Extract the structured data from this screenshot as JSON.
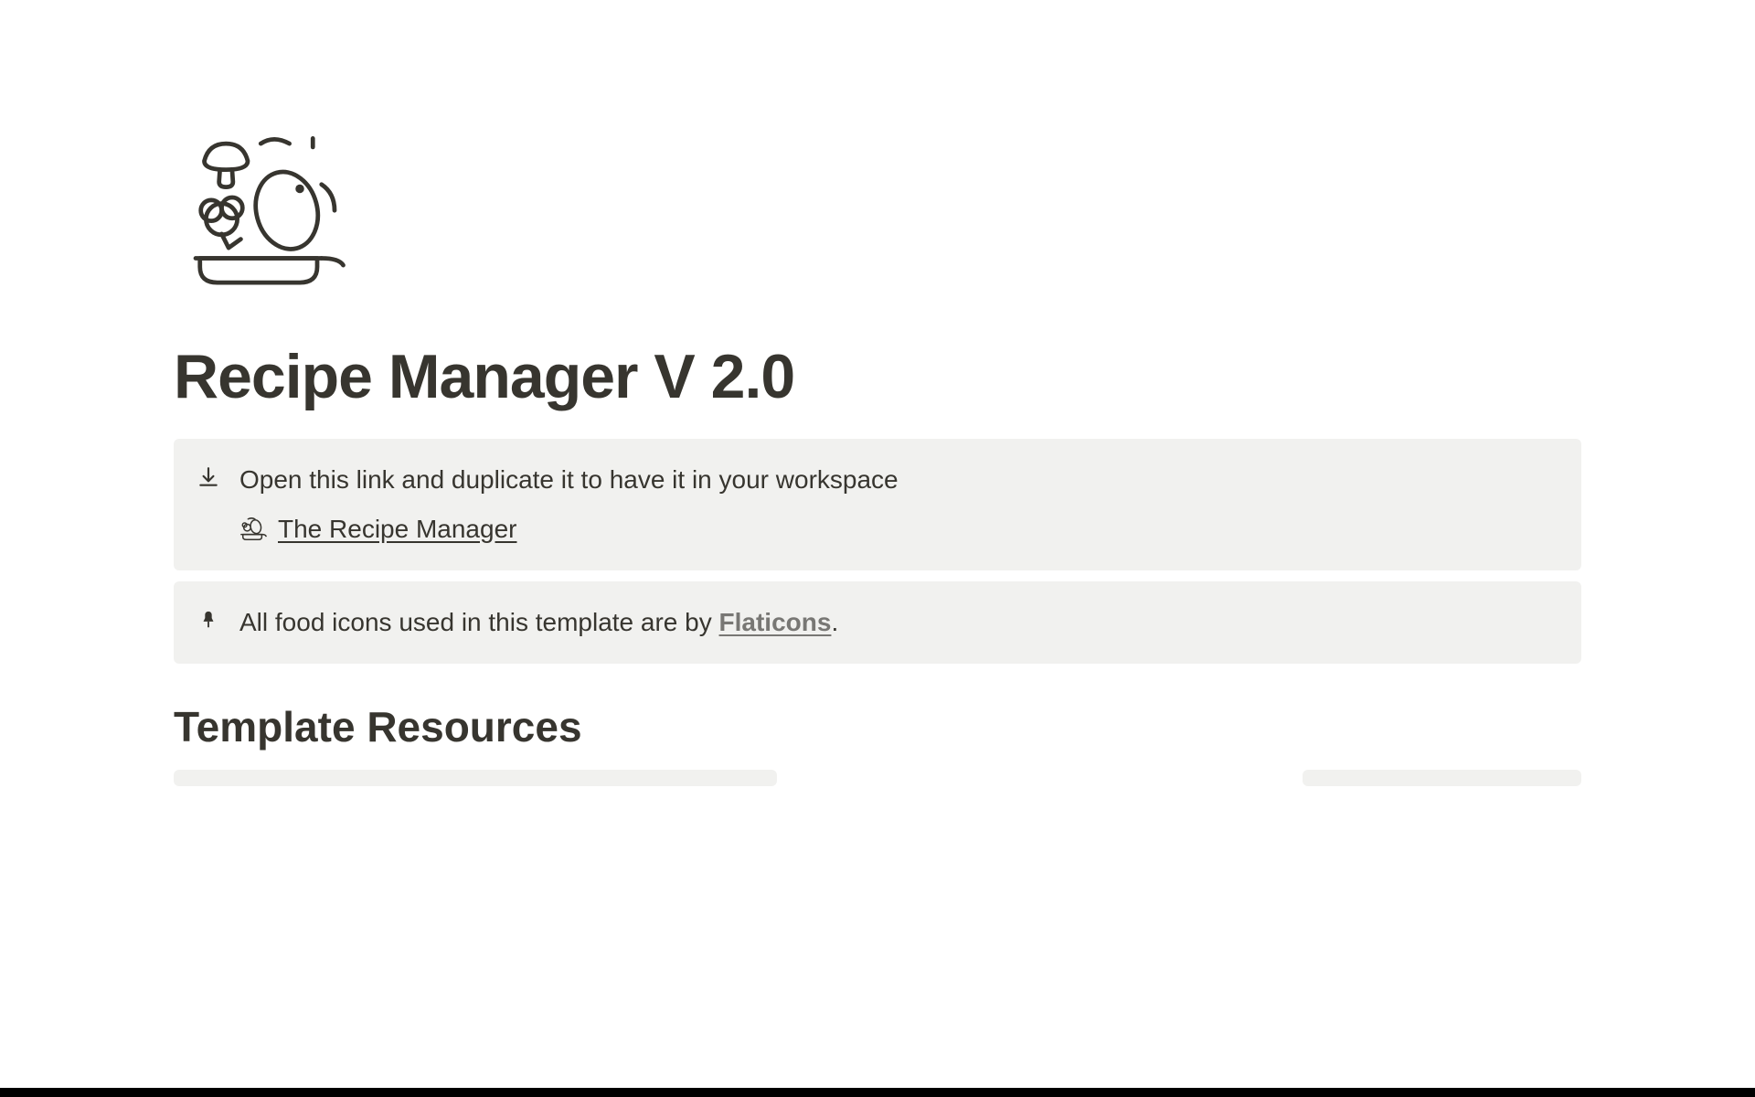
{
  "page": {
    "title": "Recipe Manager V 2.0"
  },
  "callouts": {
    "duplicate": {
      "text": "Open this link and duplicate it to have it in your workspace",
      "link_label": "The Recipe Manager"
    },
    "attribution": {
      "text_prefix": "All food icons used in this template are by ",
      "link_label": "Flaticons",
      "text_suffix": "."
    }
  },
  "sections": {
    "resources_heading": "Template Resources"
  }
}
